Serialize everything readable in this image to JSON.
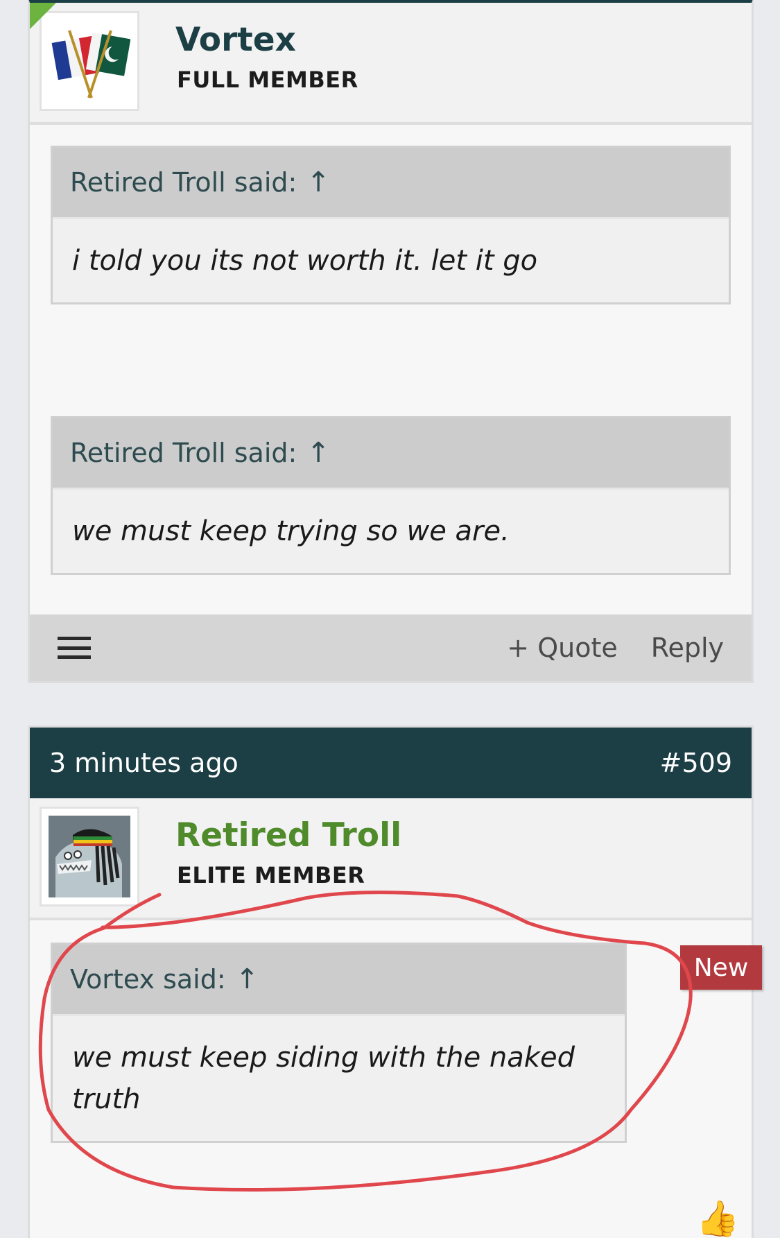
{
  "post1": {
    "username": "Vortex",
    "usertitle": "FULL MEMBER",
    "avatar_icon": "flags-avatar-icon",
    "quotes": [
      {
        "author": "Retired Troll said:",
        "arrow": "↑",
        "text": "i told you its not worth it. let it go"
      },
      {
        "author": "Retired Troll said:",
        "arrow": "↑",
        "text": "we must keep trying so we are."
      }
    ],
    "actions": {
      "quote": "+ Quote",
      "reply": "Reply"
    }
  },
  "post2": {
    "time": "3 minutes ago",
    "number": "#509",
    "username": "Retired Troll",
    "usertitle": "ELITE MEMBER",
    "avatar_icon": "troll-shark-avatar-icon",
    "badge": "New",
    "quote": {
      "author": "Vortex said:",
      "arrow": "↑",
      "text": "we must keep siding with the naked truth"
    }
  },
  "colors": {
    "header": "#1b3f45",
    "username_green": "#4f8a2b",
    "badge_red": "#b23a3f",
    "annotation_red": "#e0474c"
  }
}
